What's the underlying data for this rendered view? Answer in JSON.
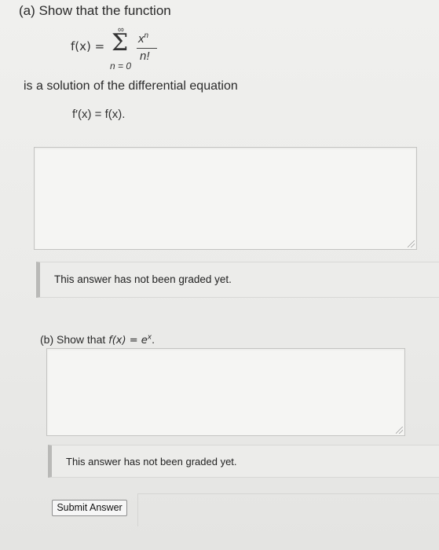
{
  "part_a": {
    "heading": "(a) Show that the function",
    "formula": {
      "lhs": "f(x) =",
      "sigma": "Σ",
      "upper": "∞",
      "lower": "n = 0",
      "numerator_base": "x",
      "numerator_exp": "n",
      "denominator": "n!"
    },
    "sentence": "is a solution of the differential equation",
    "equation": "f′(x) = f(x).",
    "answer_value": "",
    "status": "This answer has not been graded yet."
  },
  "part_b": {
    "heading_prefix": "(b) Show that ",
    "heading_math": "f(x) = e",
    "heading_exp": "x",
    "heading_suffix": ".",
    "answer_value": "",
    "status": "This answer has not been graded yet."
  },
  "submit": {
    "label": "Submit Answer"
  }
}
